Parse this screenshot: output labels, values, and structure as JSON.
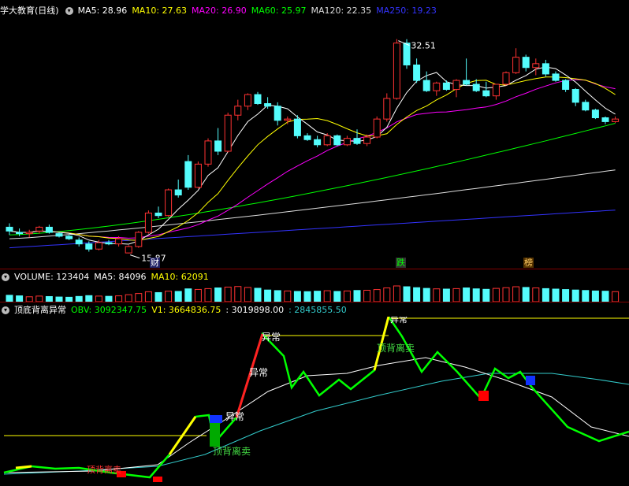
{
  "main_header": {
    "title": "学大教育(日线)",
    "ma5": "MA5: 28.96",
    "ma10": "MA10: 27.63",
    "ma20": "MA20: 26.90",
    "ma60": "MA60: 25.97",
    "ma120": "MA120: 22.35",
    "ma250": "MA250: 19.23",
    "colors": {
      "ma5": "#ffffff",
      "ma10": "#ffff00",
      "ma20": "#ff00ff",
      "ma60": "#00ff00",
      "ma120": "#dddddd",
      "ma250": "#3333ff"
    }
  },
  "volume_header": {
    "volume": "VOLUME: 123404",
    "ma5": "MA5: 84096",
    "ma10": "MA10: 62091"
  },
  "obv_header": {
    "title": "顶底背离异常",
    "obv": "OBV: 3092347.75",
    "v1": "V1: 3664836.75",
    "v2": ": 3019898.00",
    "v3": ": 2845855.50"
  },
  "flags": [
    "财",
    "跌",
    "榜"
  ],
  "annotations": {
    "high": "32.51",
    "low": "15.87",
    "abnormal": "异常",
    "top_divergence_sell": "顶背离卖"
  },
  "chart_data": {
    "type": "candlestick",
    "ylim": [
      14.5,
      34.2
    ],
    "candles": [
      [
        17.9,
        18.2,
        17.3,
        17.6
      ],
      [
        17.5,
        17.8,
        17.2,
        17.4
      ],
      [
        17.4,
        17.7,
        17.1,
        17.5
      ],
      [
        17.6,
        18.0,
        17.4,
        17.9
      ],
      [
        17.9,
        18.1,
        17.4,
        17.5
      ],
      [
        17.4,
        17.5,
        17.1,
        17.2
      ],
      [
        17.2,
        17.3,
        16.9,
        17.0
      ],
      [
        16.9,
        17.1,
        16.4,
        16.6
      ],
      [
        16.6,
        16.8,
        16.0,
        16.2
      ],
      [
        16.2,
        16.9,
        16.1,
        16.7
      ],
      [
        16.7,
        16.9,
        16.5,
        16.6
      ],
      [
        16.6,
        17.2,
        16.4,
        17.0
      ],
      [
        15.9,
        16.5,
        15.87,
        16.4
      ],
      [
        16.4,
        17.6,
        16.3,
        17.5
      ],
      [
        17.5,
        19.2,
        17.4,
        19.0
      ],
      [
        19.0,
        19.5,
        18.6,
        18.8
      ],
      [
        18.8,
        20.9,
        18.7,
        20.8
      ],
      [
        20.8,
        21.6,
        20.2,
        20.4
      ],
      [
        23.0,
        23.5,
        20.8,
        21.0
      ],
      [
        21.0,
        23.0,
        20.9,
        22.8
      ],
      [
        22.8,
        24.8,
        22.6,
        24.6
      ],
      [
        24.6,
        25.6,
        23.5,
        23.8
      ],
      [
        23.8,
        26.8,
        23.7,
        26.6
      ],
      [
        26.6,
        27.8,
        26.2,
        27.3
      ],
      [
        27.3,
        28.3,
        27.0,
        28.2
      ],
      [
        28.2,
        28.4,
        27.4,
        27.5
      ],
      [
        27.5,
        28.0,
        27.1,
        27.3
      ],
      [
        27.3,
        27.6,
        25.8,
        26.2
      ],
      [
        26.2,
        26.5,
        25.9,
        26.3
      ],
      [
        26.3,
        26.6,
        24.8,
        25.0
      ],
      [
        25.0,
        25.2,
        24.6,
        24.7
      ],
      [
        24.7,
        25.0,
        24.1,
        24.3
      ],
      [
        24.3,
        25.2,
        24.2,
        25.0
      ],
      [
        25.0,
        25.1,
        24.2,
        24.3
      ],
      [
        24.3,
        25.0,
        24.2,
        24.8
      ],
      [
        24.8,
        25.5,
        24.3,
        24.4
      ],
      [
        24.4,
        25.1,
        24.2,
        24.9
      ],
      [
        24.9,
        26.5,
        24.8,
        26.3
      ],
      [
        26.3,
        28.3,
        26.1,
        27.9
      ],
      [
        27.9,
        32.51,
        27.8,
        32.2
      ],
      [
        32.2,
        32.5,
        30.2,
        30.5
      ],
      [
        30.5,
        31.0,
        29.1,
        29.3
      ],
      [
        29.3,
        30.0,
        28.4,
        28.5
      ],
      [
        28.5,
        29.2,
        28.1,
        29.1
      ],
      [
        29.1,
        29.3,
        28.5,
        28.6
      ],
      [
        28.6,
        29.4,
        28.0,
        29.3
      ],
      [
        29.3,
        31.0,
        28.9,
        29.0
      ],
      [
        29.0,
        29.4,
        28.4,
        28.5
      ],
      [
        28.5,
        29.2,
        28.0,
        28.1
      ],
      [
        28.1,
        29.0,
        27.8,
        29.0
      ],
      [
        29.0,
        30.0,
        28.9,
        29.9
      ],
      [
        29.9,
        31.8,
        29.8,
        31.1
      ],
      [
        31.1,
        31.3,
        30.0,
        30.3
      ],
      [
        30.3,
        31.0,
        29.7,
        30.6
      ],
      [
        30.6,
        30.9,
        29.6,
        29.8
      ],
      [
        29.8,
        30.0,
        29.2,
        29.3
      ],
      [
        29.3,
        29.4,
        28.4,
        28.6
      ],
      [
        28.6,
        28.7,
        27.3,
        27.6
      ],
      [
        27.6,
        27.8,
        26.9,
        27.0
      ],
      [
        27.0,
        27.1,
        26.3,
        26.4
      ],
      [
        26.4,
        26.5,
        25.9,
        26.1
      ],
      [
        26.1,
        26.5,
        26.0,
        26.3
      ]
    ],
    "volumes": [
      55,
      50,
      42,
      48,
      44,
      40,
      38,
      45,
      52,
      48,
      46,
      50,
      60,
      70,
      85,
      78,
      90,
      88,
      110,
      105,
      112,
      118,
      125,
      130,
      122,
      115,
      100,
      95,
      92,
      88,
      86,
      90,
      94,
      88,
      92,
      96,
      98,
      104,
      118,
      135,
      128,
      120,
      114,
      110,
      108,
      112,
      118,
      110,
      106,
      114,
      120,
      128,
      122,
      118,
      112,
      108,
      104,
      100,
      96,
      92,
      90,
      86
    ]
  }
}
